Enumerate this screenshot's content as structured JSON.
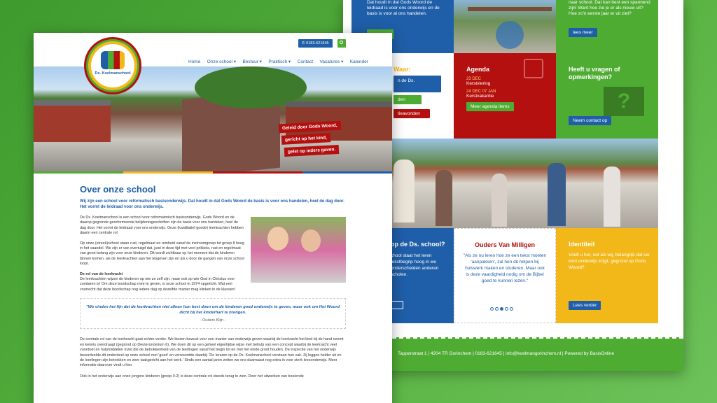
{
  "back": {
    "tile_top_blue_text": "Dat houdt in dat Gods Woord de leidraad is voor ons onderwijs en de basis is voor al ons handelen.",
    "tile_top_right_text": "naar school. Dat kan best een spannend zijn! Want hoe zie je er als nieuw uit? Hoe zo'n eerste jaar er uit ziet?",
    "lees_meer": "lees meer",
    "left_tile_heading": "Waar:",
    "left_items": [
      "n de Ds.",
      "chool",
      "den",
      "tieavonden"
    ],
    "agenda": {
      "title": "Agenda",
      "date1": "23 DEC",
      "event1": "Kerstviering",
      "date2": "24 DEC 07 JAN",
      "event2": "Kerstvakantie",
      "button": "Meer agenda items"
    },
    "vragen": {
      "title": "Heeft u vragen of opmerkingen?",
      "button": "Neem contact op"
    },
    "ds_tile": {
      "title": "op de Ds. school?",
      "text": "chool staat het leren tekstbegrip hoog in we onderscheiden anderen scholen."
    },
    "ouders": {
      "title": "Ouders Van Milligen",
      "quote": "\"Als ze nu leren hoe ze een tekst moeten 'aanpakken', zal hen dit helpen bij huiswerk maken en studeren. Maar ook is deze vaardigheid nodig om de Bijbel goed te kunnen lezen.\""
    },
    "identiteit": {
      "title": "Identiteit",
      "text": "Vindt u het, net als wij, belangrijk dat uw kind onderwijs krijgt, gegrond op Gods Woord?",
      "button": "Lees verder"
    },
    "footer": "Tapperstraat 1  |  4204 TR Gorinchem  |  0183-621645  |  info@koelmangorinchem.nl  |  Powered by BasisOnline"
  },
  "front": {
    "phone": "0183-621645",
    "logo_name": "Ds. Koelmanschool",
    "nav": [
      "Home",
      "Onze school ▾",
      "Bestuur ▾",
      "Praktisch ▾",
      "Contact",
      "Vacatures ▾",
      "Kalender"
    ],
    "hero_lines": [
      "Geleid door Gods Woord,",
      "gericht op het kind,",
      "gelet op ieders gaven."
    ],
    "title": "Over onze school",
    "intro": "Wij zijn een school voor reformatisch basisonderwijs. Dat houdt in dat Gods Woord de basis is voor ons handelen, heel de dag door. Het vormt de leidraad voor ons onderwijs.",
    "p1": "De Ds. Koelmanschool is een school voor reformatorisch basisonderwijs. Gods Woord en de daarop gegronde gereformeerde belijdenisgeschriften zijn de basis voor ons handelen, heel de dag door. Het vormt de leidraad voor ons onderwijs. Onze (kwalitatief goede) leerkrachten hebben daarin een centrale rol.",
    "p2": "Op onze (streek)school staan rust, regelmaat en reinheid vanaf de instroomgroep tot groep 8 hoog in het vaandel. We zijn er van overtuigd dat, juist in deze tijd met veel prikkels, rust en regelmaat van groot belang zijn voor onze kinderen. Dit wordt zichtbaar op het moment dat de kinderen binnen komen, als de leerkrachten aan het lesgeven zijn en als u door de gangen van onze school loopt.",
    "rol_heading": "De rol van de leerkracht",
    "p3": "De leerkrachten wijzen de kinderen op wie ze zelf zijn, maar ook op wie God in Christus voor zondaren is! Om deze boodschap mee te geven, is onze school in 1974 opgericht. Wat een voorrecht dat deze boodschap nog iedere dag op dezelfde manier mag klinken in de klassen!",
    "quote": "\"We vinden het fijn dat de leerkrachten niet alleen hun best doen om de kinderen goed onderwijs te geven, maar ook om Het Woord dicht bij het kinderhart te brengen.",
    "quote_source": "- Ouders Klijn -",
    "p4": "De centrale rol van de leerkracht gaat echter verder. We kiezen bewust voor een manier van onderwijs geven waarbij de leerkracht het kind bij de hand neemt en kennis overdraagt (gegrond op Deuteronomium 6). We doen dit op een geheel eigentijdse wijze met behulp van een concept waarbij de leerkracht veel voordoet en hulpmiddelen inzet die de betrokkenheid van de leerlingen vanaf het begin tot en met het einde groot houden. De inspectie van het onderwijs beoordeelde dit onderdeel op onze school met 'goed' en verwoordde daarbij: 'De leraren op de Ds. Koelmanschool verstaan hun vak. Zij leggen helder uit en de leerlingen zijn betrokken en zeer taakgericht aan het werk.' Sinds een aantal jaren zetten we ons daarnaast nog extra in voor sterk leesonderwijs. Meer informatie daarover vindt u hier.",
    "p5": "Ook in het onderwijs aan onze jongere kinderen (groep 0-2) is deze centrale rol steeds terug te zien. Door het uitwerken van boeiende"
  },
  "colors": {
    "blue": "#1f5ea8",
    "green": "#4fac33",
    "red": "#b3100f",
    "yellow": "#f2b81a"
  }
}
